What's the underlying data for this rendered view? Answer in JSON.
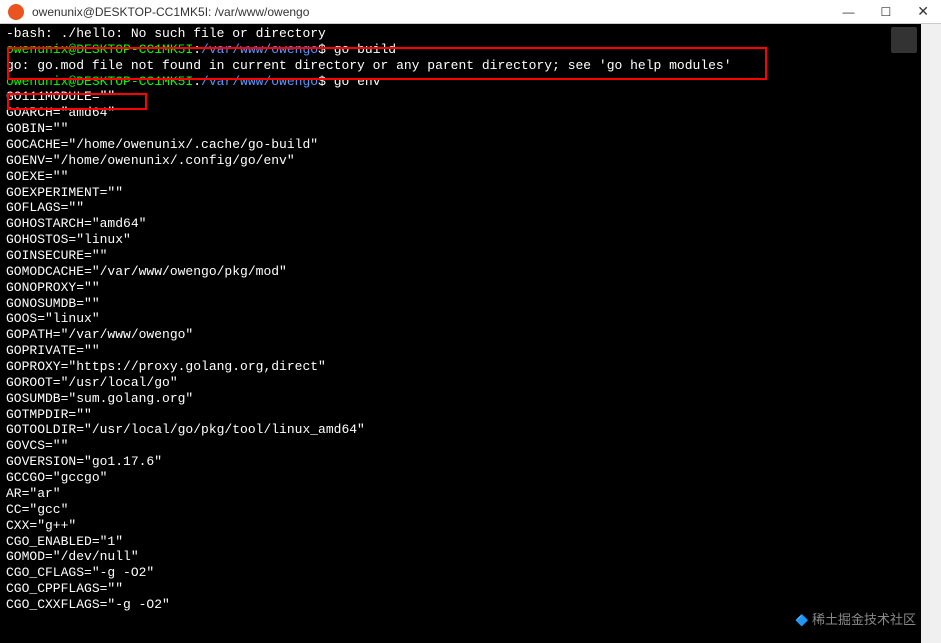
{
  "titlebar": {
    "title": "owenunix@DESKTOP-CC1MK5I: /var/www/owengo"
  },
  "terminal": {
    "bash_error": "-bash: ./hello: No such file or directory",
    "prompt": {
      "user": "owenunix@DESKTOP-CC1MK5I",
      "colon": ":",
      "path": "/var/www/owengo",
      "symbol": "$"
    },
    "cmd1": "go build",
    "err1": "go: go.mod file not found in current directory or any parent directory; see 'go help modules'",
    "cmd2": "go env",
    "env": [
      "GO111MODULE=\"\"",
      "GOARCH=\"amd64\"",
      "GOBIN=\"\"",
      "GOCACHE=\"/home/owenunix/.cache/go-build\"",
      "GOENV=\"/home/owenunix/.config/go/env\"",
      "GOEXE=\"\"",
      "GOEXPERIMENT=\"\"",
      "GOFLAGS=\"\"",
      "GOHOSTARCH=\"amd64\"",
      "GOHOSTOS=\"linux\"",
      "GOINSECURE=\"\"",
      "GOMODCACHE=\"/var/www/owengo/pkg/mod\"",
      "GONOPROXY=\"\"",
      "GONOSUMDB=\"\"",
      "GOOS=\"linux\"",
      "GOPATH=\"/var/www/owengo\"",
      "GOPRIVATE=\"\"",
      "GOPROXY=\"https://proxy.golang.org,direct\"",
      "GOROOT=\"/usr/local/go\"",
      "GOSUMDB=\"sum.golang.org\"",
      "GOTMPDIR=\"\"",
      "GOTOOLDIR=\"/usr/local/go/pkg/tool/linux_amd64\"",
      "GOVCS=\"\"",
      "GOVERSION=\"go1.17.6\"",
      "GCCGO=\"gccgo\"",
      "AR=\"ar\"",
      "CC=\"gcc\"",
      "CXX=\"g++\"",
      "CGO_ENABLED=\"1\"",
      "GOMOD=\"/dev/null\"",
      "CGO_CFLAGS=\"-g -O2\"",
      "CGO_CPPFLAGS=\"\"",
      "CGO_CXXFLAGS=\"-g -O2\""
    ]
  },
  "watermark": "稀土掘金技术社区"
}
